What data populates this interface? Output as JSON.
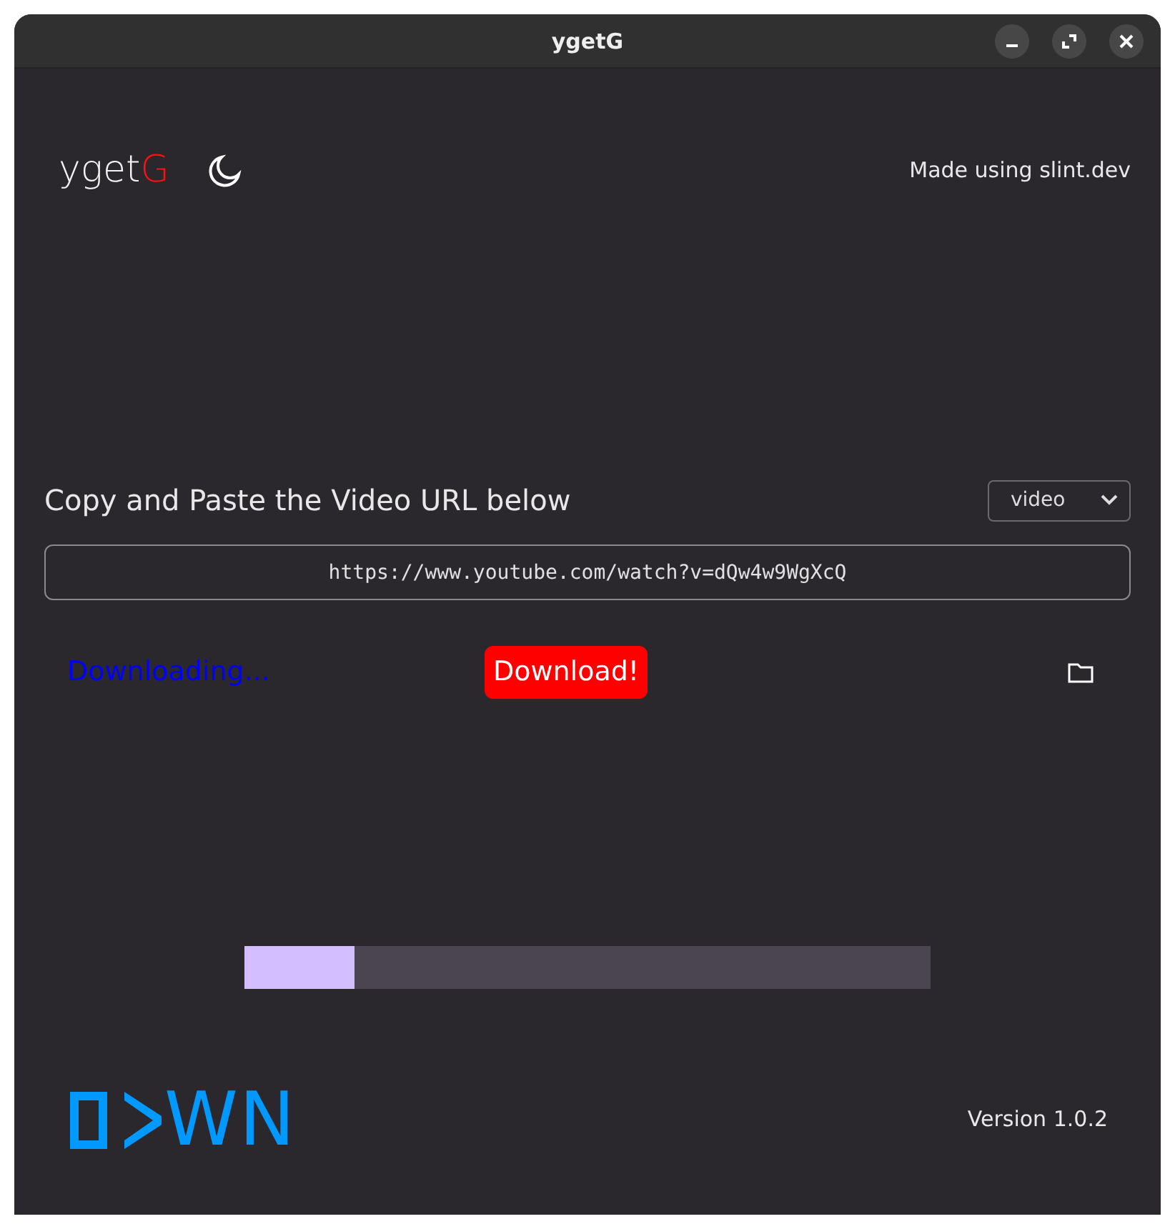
{
  "window": {
    "title": "ygetG"
  },
  "header": {
    "brand": "yget",
    "brand_accent": "G",
    "credit": "Made using slint.dev"
  },
  "prompt": "Copy and Paste the Video URL below",
  "format_select": {
    "value": "video"
  },
  "url_field": {
    "value": "https://www.youtube.com/watch?v=dQw4w9WgXcQ"
  },
  "status": "Downloading...",
  "download_button": "Download!",
  "progress": {
    "level": 0.16
  },
  "footer": {
    "logo_text": "WN",
    "version": "Version 1.0.2"
  }
}
